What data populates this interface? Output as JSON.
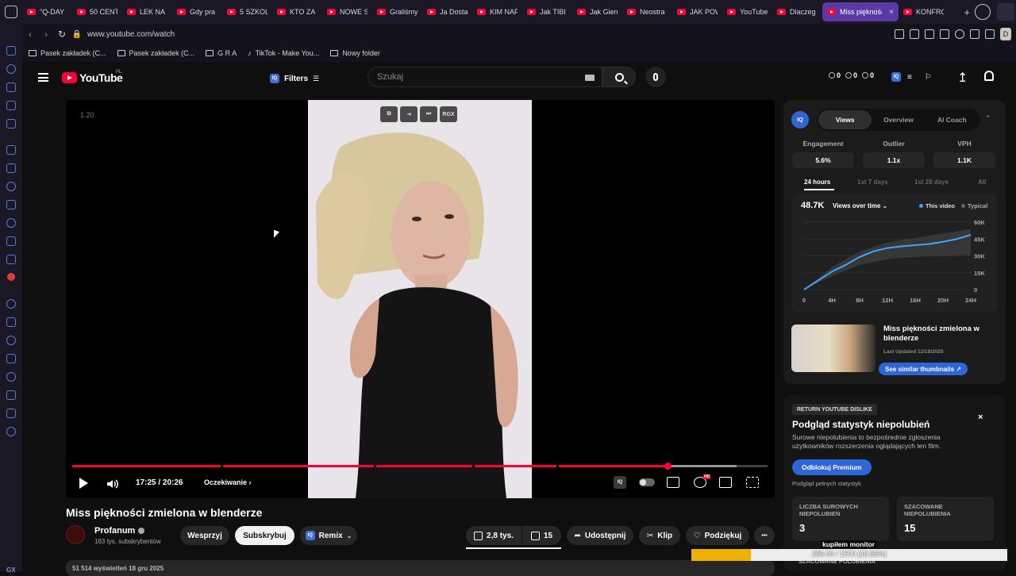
{
  "browser": {
    "tabs": [
      {
        "label": "\"Q-DAY"
      },
      {
        "label": "50 CENT"
      },
      {
        "label": "LEK NA"
      },
      {
        "label": "Gdy pra"
      },
      {
        "label": "5 SZKOL"
      },
      {
        "label": "KTO ZA"
      },
      {
        "label": "NOWE S"
      },
      {
        "label": "Graliśmy"
      },
      {
        "label": "Ja Dosta"
      },
      {
        "label": "KIM NAF"
      },
      {
        "label": "Jak TIBI"
      },
      {
        "label": "Jak Gien"
      },
      {
        "label": "Neostra"
      },
      {
        "label": "JAK POW"
      },
      {
        "label": "YouTube"
      },
      {
        "label": "Dlaczeg"
      },
      {
        "label": "Miss piękności z",
        "active": true
      },
      {
        "label": "KONFRO"
      }
    ],
    "tab_close": "×",
    "new_tab": "+",
    "url": "www.youtube.com/watch",
    "profile_initial": "D",
    "bookmarks": [
      {
        "label": "Pasek zakładek (C...",
        "icon": "folder-icon"
      },
      {
        "label": "Pasek zakładek (C...",
        "icon": "folder-icon"
      },
      {
        "label": "G R A",
        "icon": "folder-icon"
      },
      {
        "label": "TikTok - Make You...",
        "icon": "tiktok-icon"
      },
      {
        "label": "Nowy folder",
        "icon": "folder-icon"
      }
    ],
    "sidebar_footer": "GX"
  },
  "youtube": {
    "logo_text": "YouTube",
    "region": "PL",
    "filters_label": "Filters",
    "search_placeholder": "Szukaj",
    "iq_badge": "IQ",
    "counters": [
      "0",
      "0",
      "0"
    ]
  },
  "player": {
    "speed_overlay": "1.20",
    "frame_buttons": [
      "⧉",
      "⇥",
      "⏭",
      "RGX"
    ],
    "time_current": "17:25",
    "time_total": "20:26",
    "timecode": "17:25 / 20:26",
    "chapter": "Oczekiwanie",
    "progress": 0.856,
    "buffered": 0.956,
    "hd_badge": "HD",
    "accent": "#ff0033"
  },
  "video": {
    "title": "Miss piękności zmielona w blenderze",
    "channel": "Profanum",
    "subscribers": "163 tys. subskrybentów",
    "support_label": "Wesprzyj",
    "subscribe_label": "Subskrybuj",
    "remix_label": "Remix",
    "likes": "2,8 tys.",
    "dislikes": "15",
    "share_label": "Udostępnij",
    "clip_label": "Klip",
    "thanks_label": "Podziękuj",
    "more_label": "•••",
    "description_line": "51 514 wyświetleń  18 gru 2025"
  },
  "iq_panel": {
    "logo": "IQ",
    "tabs": [
      {
        "label": "Views",
        "active": true
      },
      {
        "label": "Overview"
      },
      {
        "label": "AI Coach"
      }
    ],
    "collapse": "⌃",
    "metrics": [
      {
        "label": "Engagement",
        "value": "5.6%"
      },
      {
        "label": "Outlier",
        "value": "1.1x"
      },
      {
        "label": "VPH",
        "value": "1.1K"
      }
    ],
    "ranges": [
      {
        "label": "24 hours",
        "active": true
      },
      {
        "label": "1st 7 days"
      },
      {
        "label": "1st 28 days"
      },
      {
        "label": "All"
      }
    ],
    "chart_total": "48.7K",
    "chart_mode": "Views over time",
    "legend_this": "This video",
    "legend_typical": "Typical",
    "similar_title": "Miss piękności zmielona w blenderze",
    "similar_date": "Last Updated 12/18/2025",
    "similar_button": "See similar thumbnails ↗",
    "colors": {
      "line": "#3ea6ff",
      "band": "#3a3a3a"
    }
  },
  "chart_data": {
    "type": "line",
    "title": "",
    "xlabel": "",
    "ylabel": "",
    "categories": [
      "0",
      "4H",
      "8H",
      "12H",
      "16H",
      "20H",
      "24H"
    ],
    "y_ticks": [
      "60K",
      "45K",
      "30K",
      "15K",
      "0"
    ],
    "ylim": [
      0,
      60000
    ],
    "series": [
      {
        "name": "This video",
        "x": [
          0,
          2,
          4,
          6,
          8,
          10,
          12,
          14,
          16,
          18,
          20,
          22,
          24
        ],
        "values": [
          0,
          8000,
          16000,
          22000,
          29000,
          34000,
          37000,
          38500,
          39500,
          40500,
          42500,
          45000,
          48700
        ]
      },
      {
        "name": "Typical",
        "x": [
          0,
          4,
          8,
          12,
          16,
          20,
          24
        ],
        "low": [
          0,
          12000,
          22000,
          27000,
          29000,
          30000,
          31000
        ],
        "high": [
          0,
          20000,
          34000,
          42000,
          46000,
          50000,
          54000
        ]
      }
    ],
    "legend": "top-right",
    "grid": true
  },
  "dislike_panel": {
    "badge": "RETURN YOUTUBE DISLIKE",
    "title": "Podgląd statystyk niepolubień",
    "description": "Surowe niepolubienia to bezpośrednie zgłoszenia użytkowników rozszerzenia oglądających ten film.",
    "unlock_label": "Odblokuj Premium",
    "preview_label": "Podgląd pełnych statystyk",
    "cards": [
      {
        "label": "LICZBA SUROWYCH NIEPOLUBIEŃ",
        "value": "3"
      },
      {
        "label": "SZACOWANE NIEPOLUBIENIA",
        "value": "15"
      }
    ],
    "bottom_label": "SZACOWANE POLUBIENIA",
    "close": "×"
  },
  "download": {
    "label": "kupiłem monitor",
    "progress_text": "286.00 / 1500 (18.86%)",
    "progress": 0.1886
  }
}
